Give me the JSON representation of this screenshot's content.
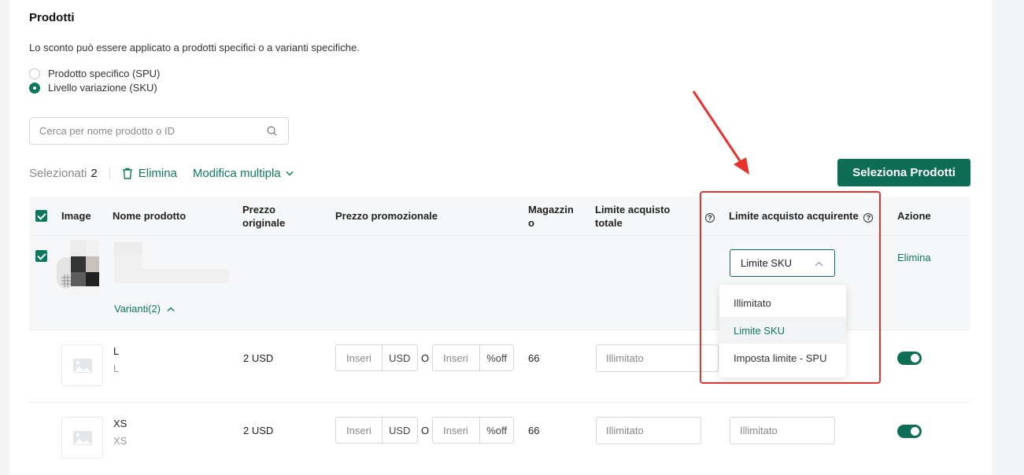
{
  "section": {
    "title": "Prodotti",
    "description": "Lo sconto può essere applicato a prodotti specifici o a varianti specifiche.",
    "radios": [
      {
        "label": "Prodotto specifico (SPU)",
        "checked": false
      },
      {
        "label": "Livello variazione (SKU)",
        "checked": true
      }
    ]
  },
  "search": {
    "placeholder": "Cerca per nome prodotto o ID",
    "icon": "search-icon"
  },
  "toolbar": {
    "selected_label": "Selezionati",
    "selected_count": "2",
    "delete_label": "Elimina",
    "bulk_edit_label": "Modifica multipla",
    "select_products_label": "Seleziona Prodotti"
  },
  "table": {
    "headers": {
      "image": "Image",
      "name": "Nome prodotto",
      "original_price_1": "Prezzo",
      "original_price_2": "originale",
      "promo_price": "Prezzo promozionale",
      "stock_1": "Magazzin",
      "stock_2": "o",
      "total_limit_1": "Limite acquisto",
      "total_limit_2": "totale",
      "buyer_limit": "Limite acquisto acquirente",
      "action": "Azione"
    },
    "product": {
      "variants_label": "Varianti(2)",
      "limit_select_value": "Limite SKU",
      "action_label": "Elimina"
    },
    "variants": [
      {
        "name": "L",
        "sub": "L",
        "original_price": "2 USD",
        "promo_placeholder": "Inseri",
        "currency": "USD",
        "or": "O",
        "pct_placeholder": "Inseri",
        "pct_unit": "%off",
        "stock": "66",
        "total_limit_placeholder": "Illimitato",
        "buyer_limit_placeholder": "Illimitato",
        "enabled": true
      },
      {
        "name": "XS",
        "sub": "XS",
        "original_price": "2 USD",
        "promo_placeholder": "Inseri",
        "currency": "USD",
        "or": "O",
        "pct_placeholder": "Inseri",
        "pct_unit": "%off",
        "stock": "66",
        "total_limit_placeholder": "Illimitato",
        "buyer_limit_placeholder": "Illimitato",
        "enabled": true
      }
    ]
  },
  "dropdown": {
    "options": [
      {
        "label": "Illimitato",
        "active": false
      },
      {
        "label": "Limite SKU",
        "active": true
      },
      {
        "label": "Imposta limite - SPU",
        "active": false
      }
    ]
  },
  "colors": {
    "accent": "#0d6e55",
    "annotation": "#e8322e"
  }
}
